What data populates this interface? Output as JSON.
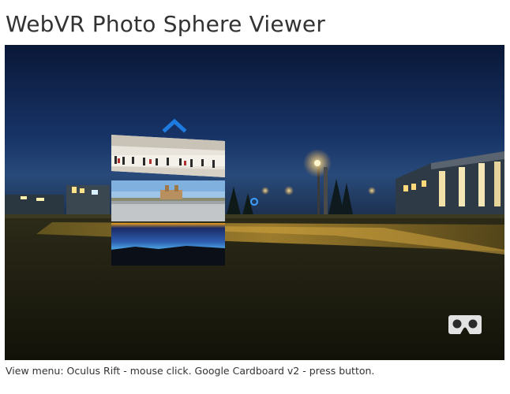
{
  "page": {
    "title": "WebVR Photo Sphere Viewer",
    "caption": "View menu: Oculus Rift - mouse click. Google Cardboard v2 - press button."
  },
  "viewer": {
    "menu": {
      "up_arrow_icon": "chevron-up-icon",
      "thumbnails": [
        {
          "name": "interior-panorama"
        },
        {
          "name": "plaza-panorama"
        },
        {
          "name": "night-sky-panorama"
        }
      ]
    },
    "vr_button_icon": "cardboard-vr-icon",
    "colors": {
      "sky_top": "#0c1c45",
      "sky_horizon": "#1d3a6a",
      "ground": "#1f1f14",
      "accent": "#1e7be0"
    }
  }
}
